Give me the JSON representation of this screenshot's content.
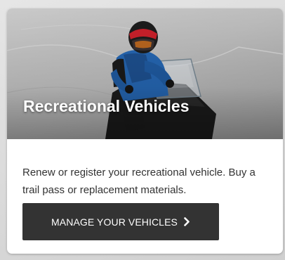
{
  "card": {
    "title": "Recreational Vehicles",
    "description": "Renew or register your recreational vehicle. Buy a trail pass or replacement materials.",
    "button_label": "MANAGE YOUR VEHICLES",
    "button_icon": "chevron-right-icon",
    "hero_image": "snowmobile-rider-photo"
  },
  "colors": {
    "button_bg": "#333333",
    "button_text": "#ffffff",
    "title_text": "#ffffff",
    "body_text": "#333333"
  }
}
